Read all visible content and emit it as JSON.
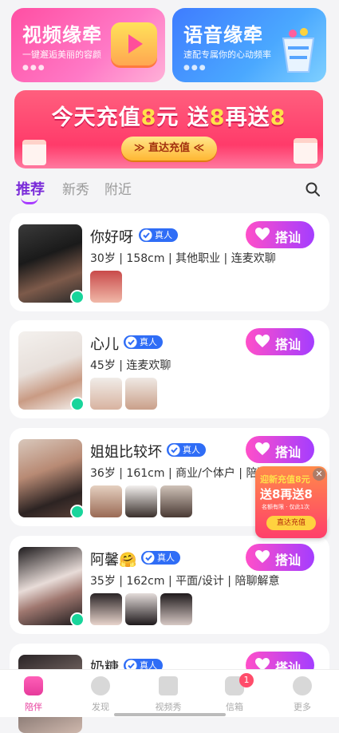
{
  "top_cards": {
    "video": {
      "title": "视频缘牵",
      "subtitle": "一键邂逅美丽的容颜"
    },
    "voice": {
      "title": "语音缘牵",
      "subtitle": "速配专属你的心动频率"
    }
  },
  "banner": {
    "part1": "今天充值",
    "num1": "8",
    "part2": "元 送",
    "num2": "8",
    "part3": "再送",
    "num3": "8",
    "button": "≫ 直达充值 ≪"
  },
  "tabs": {
    "recommend": "推荐",
    "new": "新秀",
    "nearby": "附近"
  },
  "greet_label": "搭讪",
  "verified_label": "真人",
  "users": [
    {
      "name": "你好呀",
      "info": "30岁 | 158cm | 其他职业 | 连麦欢聊"
    },
    {
      "name": "心儿",
      "info": "45岁 | 连麦欢聊"
    },
    {
      "name": "姐姐比较坏",
      "info": "36岁 | 161cm | 商业/个体户 | 陪聊解意"
    },
    {
      "name": "阿馨🤗",
      "info": "35岁 | 162cm | 平面/设计 | 陪聊解意"
    },
    {
      "name": "奶糖",
      "info": ""
    }
  ],
  "float_promo": {
    "line1": "迎新充值8元",
    "line2": "送8再送8",
    "line3": "名额有限 · 仅此1次",
    "button": "直达充值"
  },
  "nav": {
    "items": [
      "陪伴",
      "发现",
      "视频秀",
      "信箱",
      "更多"
    ],
    "message_count": "1"
  }
}
